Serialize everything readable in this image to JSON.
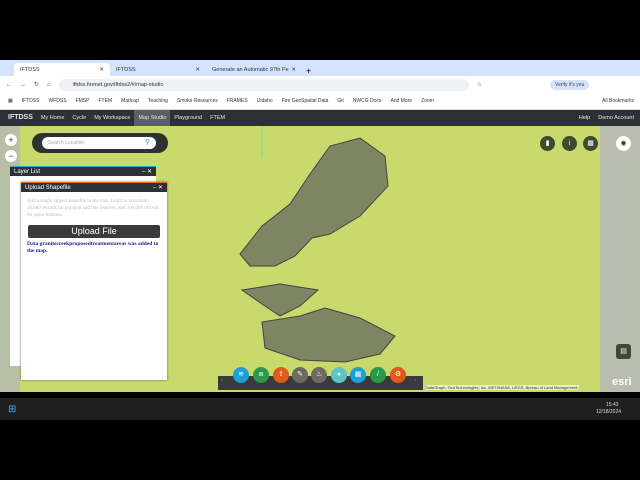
{
  "browser": {
    "tabs": [
      {
        "label": "IFTDSS",
        "active": true
      },
      {
        "label": "IFTDSS",
        "active": false
      },
      {
        "label": "Generate an Automatic 97th Pe",
        "active": false
      }
    ],
    "url": "iftdss.firenet.gov/iftdss2/#/map-studio",
    "verify": "Verify it's you",
    "bookmarks": [
      "IFTDSS",
      "WFDSS",
      "FMSP",
      "FTEM",
      "Madcap",
      "Teaching",
      "Smoke Resources",
      "FRAMES",
      "UIdaho",
      "Fire GeoSpatial Data",
      "Git",
      "NWCG Docs",
      "And More",
      "Zoom"
    ],
    "all_bookmarks": "All Bookmarks"
  },
  "app": {
    "logo": "IFTDSS",
    "nav": [
      {
        "label": "My Home"
      },
      {
        "label": "Cycle"
      },
      {
        "label": "My Workspace"
      },
      {
        "label": "Map Studio",
        "active": true
      },
      {
        "label": "Playground"
      },
      {
        "label": "FTEM"
      }
    ],
    "help": "Help",
    "account": "Demo Account"
  },
  "map": {
    "search_placeholder": "Search Location",
    "attribution": "SafeGraph, GeoTechnologies, Inc, METI/NASA, USGS, Bureau of Land Management,",
    "esri": "esri"
  },
  "layer_list": {
    "title": "Layer List"
  },
  "upload": {
    "title": "Upload Shapefile",
    "instructions": "Add a single zipped shapefile to the map. Limit to maximum 30,000 records for polygon and line features, and 100,000 records for point features.",
    "button": "Upload File",
    "message": "Data granitecreekproposedtreatmentareas was added to the map."
  },
  "taskbar": {
    "time": "15:43",
    "date": "12/18/2024"
  },
  "colors": {
    "nav": "#2d3136",
    "message": "#1a1a8c"
  }
}
